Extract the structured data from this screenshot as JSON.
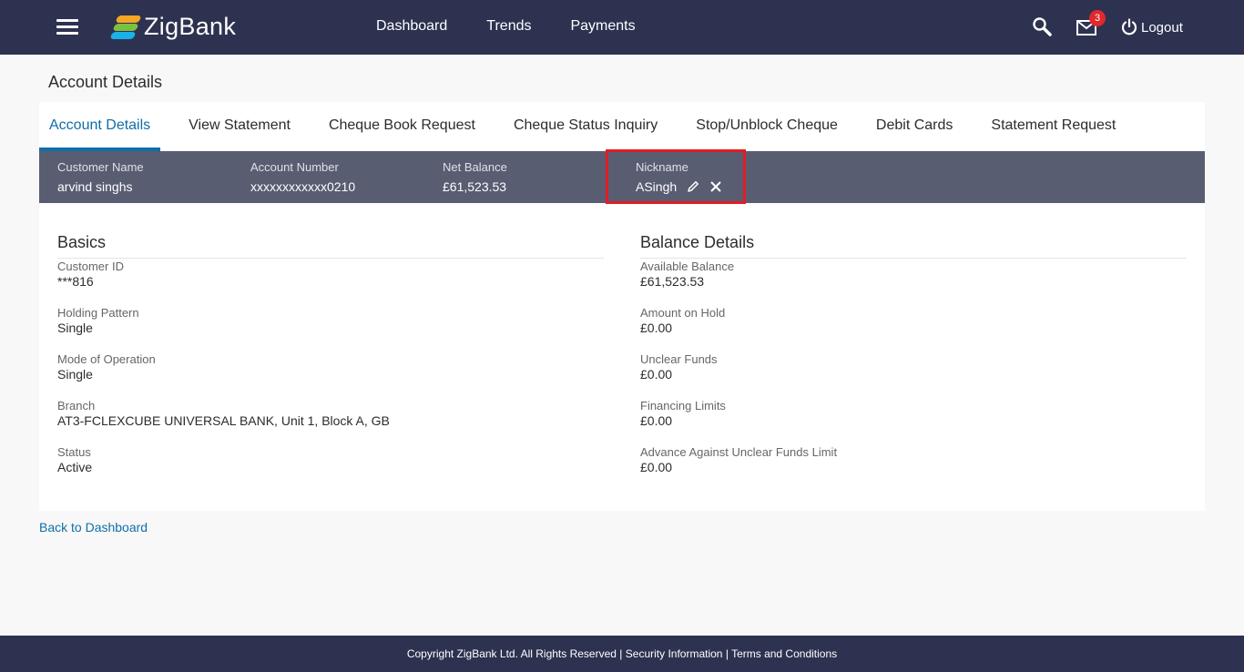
{
  "header": {
    "brand": "ZigBank",
    "nav": [
      "Dashboard",
      "Trends",
      "Payments"
    ],
    "mail_badge": "3",
    "logout_label": "Logout"
  },
  "page_title": "Account Details",
  "tabs": [
    "Account Details",
    "View Statement",
    "Cheque Book Request",
    "Cheque Status Inquiry",
    "Stop/Unblock Cheque",
    "Debit Cards",
    "Statement Request"
  ],
  "active_tab": "Account Details",
  "summary": {
    "customer_name": {
      "label": "Customer Name",
      "value": "arvind singhs"
    },
    "account_number": {
      "label": "Account Number",
      "value": "xxxxxxxxxxxx0210"
    },
    "net_balance": {
      "label": "Net Balance",
      "value": "£61,523.53"
    },
    "nickname": {
      "label": "Nickname",
      "value": "ASingh"
    }
  },
  "basics": {
    "title": "Basics",
    "fields": [
      {
        "label": "Customer ID",
        "value": "***816"
      },
      {
        "label": "Holding Pattern",
        "value": "Single"
      },
      {
        "label": "Mode of Operation",
        "value": "Single"
      },
      {
        "label": "Branch",
        "value": "AT3-FCLEXCUBE UNIVERSAL BANK, Unit 1, Block A, GB"
      },
      {
        "label": "Status",
        "value": "Active"
      }
    ]
  },
  "balance_details": {
    "title": "Balance Details",
    "fields": [
      {
        "label": "Available Balance",
        "value": "£61,523.53"
      },
      {
        "label": "Amount on Hold",
        "value": "£0.00"
      },
      {
        "label": "Unclear Funds",
        "value": "£0.00"
      },
      {
        "label": "Financing Limits",
        "value": "£0.00"
      },
      {
        "label": "Advance Against Unclear Funds Limit",
        "value": "£0.00"
      }
    ]
  },
  "back_link": "Back to Dashboard",
  "footer": {
    "copyright": "Copyright ZigBank Ltd. All Rights Reserved",
    "separator": "|",
    "security": "Security Information",
    "terms": "Terms and Conditions"
  },
  "colors": {
    "header_bg": "#2d3250",
    "accent": "#0f6fa8",
    "summary_bg": "#585d72",
    "highlight": "#e01e24"
  }
}
